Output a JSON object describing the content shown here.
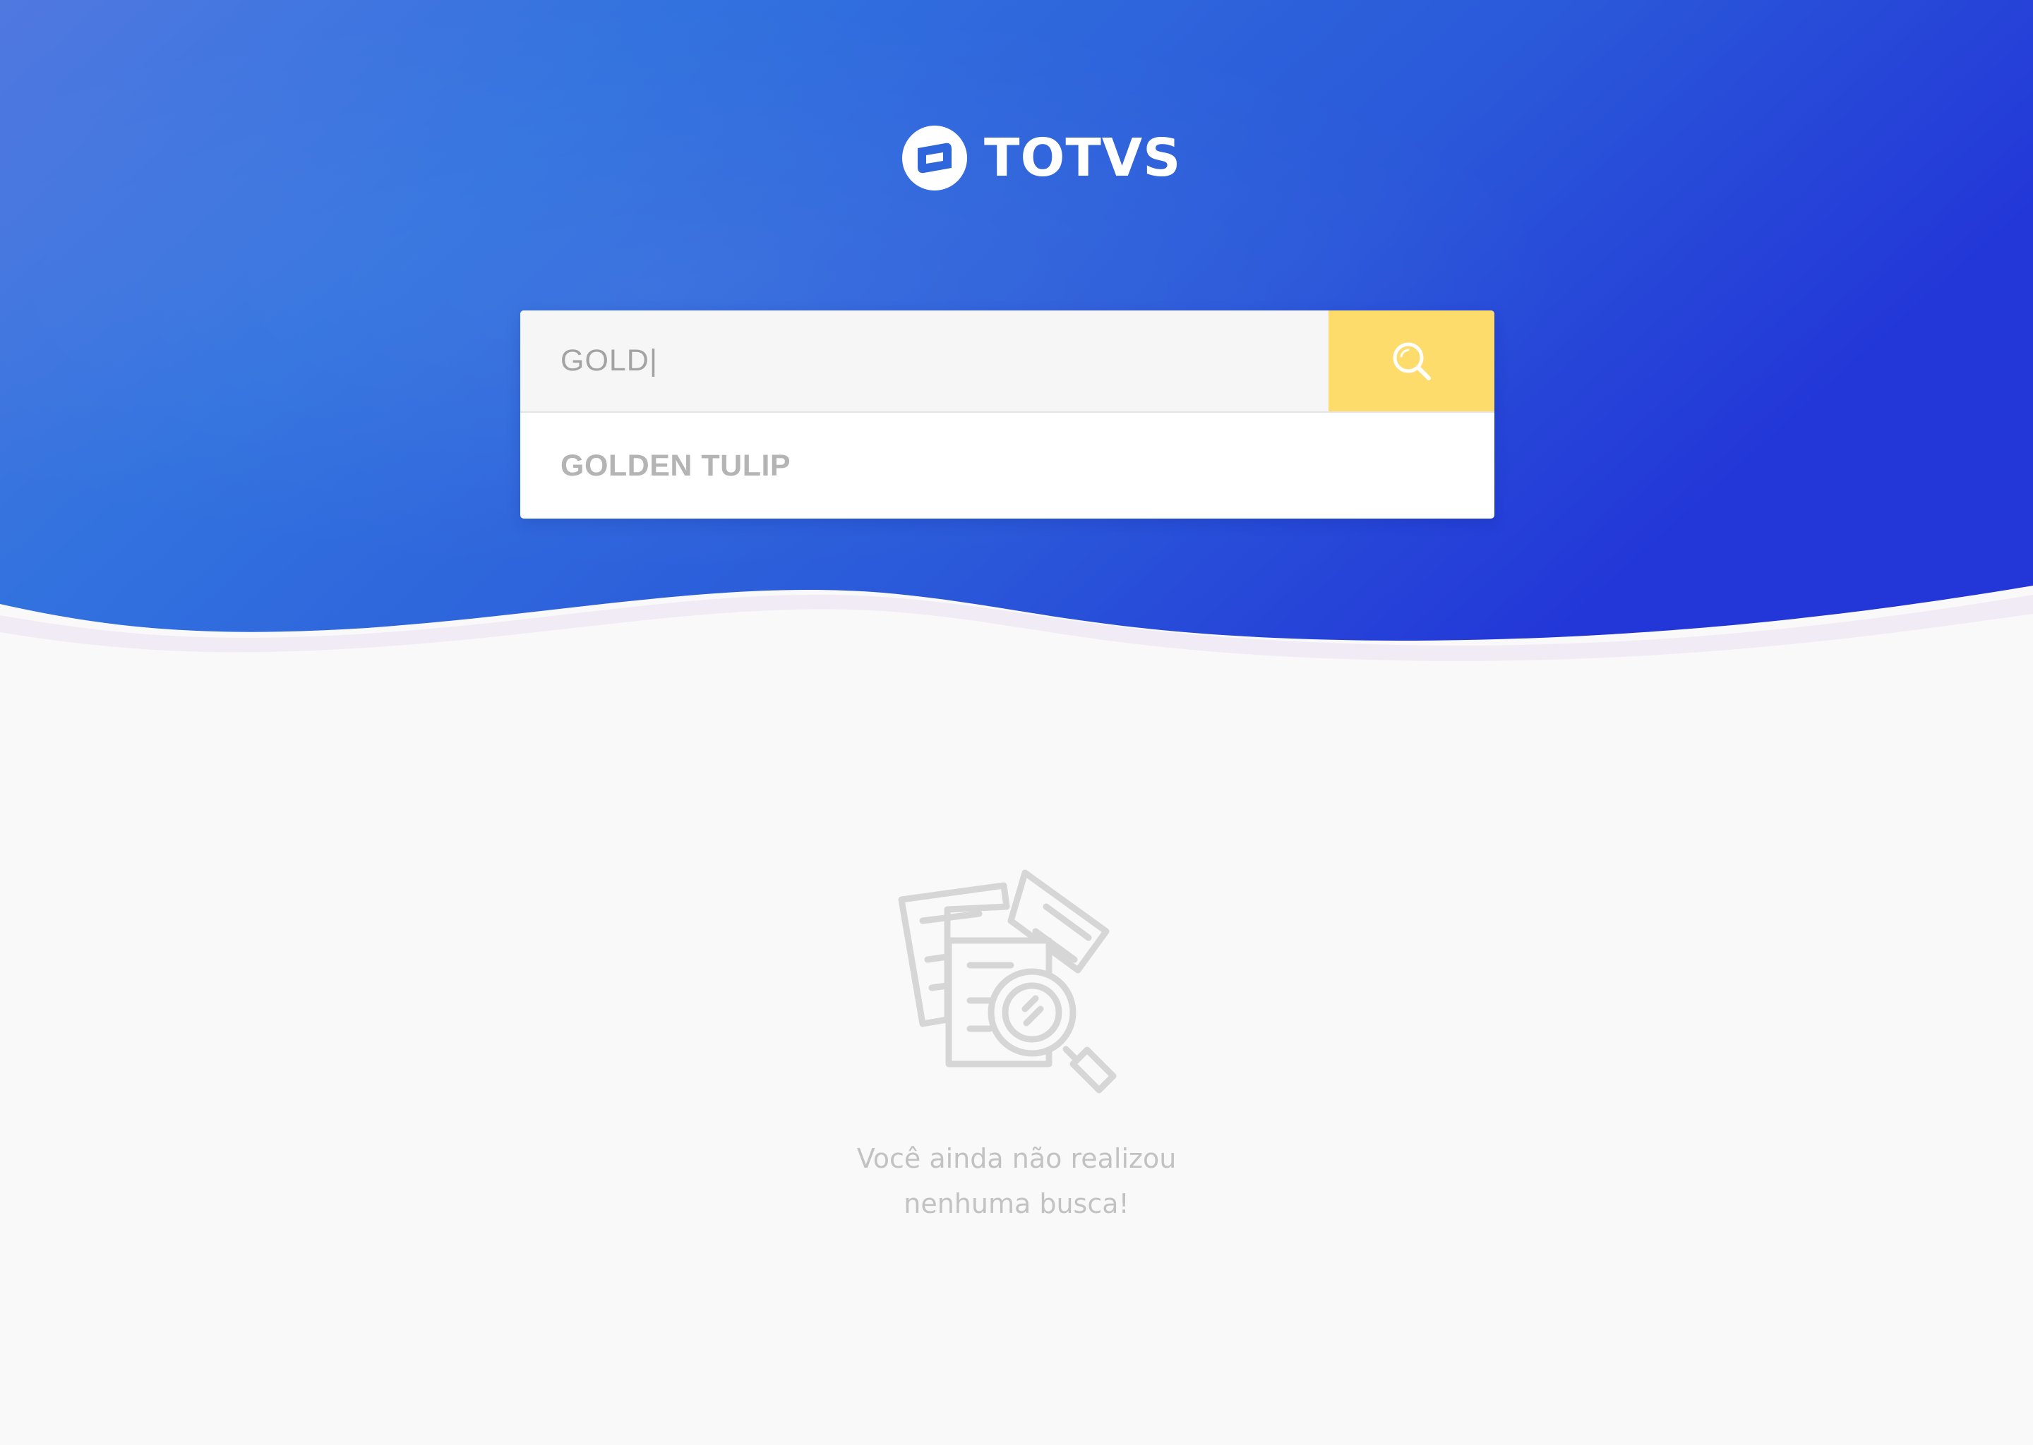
{
  "brand": {
    "name": "TOTVS",
    "logo_icon": "totvs-logo-icon"
  },
  "search": {
    "value": "GOLD|",
    "button_icon": "search-icon",
    "suggestions": [
      {
        "label": "GOLDEN TULIP"
      }
    ]
  },
  "empty_state": {
    "illustration_icon": "documents-search-icon",
    "line1": "Você ainda não realizou",
    "line2": "nenhuma busca!"
  },
  "colors": {
    "hero_start": "#4e78e0",
    "hero_mid": "#2f6cdc",
    "hero_end": "#2337d8",
    "search_button": "#fddc6b",
    "page_background": "#f9f9f9",
    "muted_text": "#c2c2c2"
  }
}
